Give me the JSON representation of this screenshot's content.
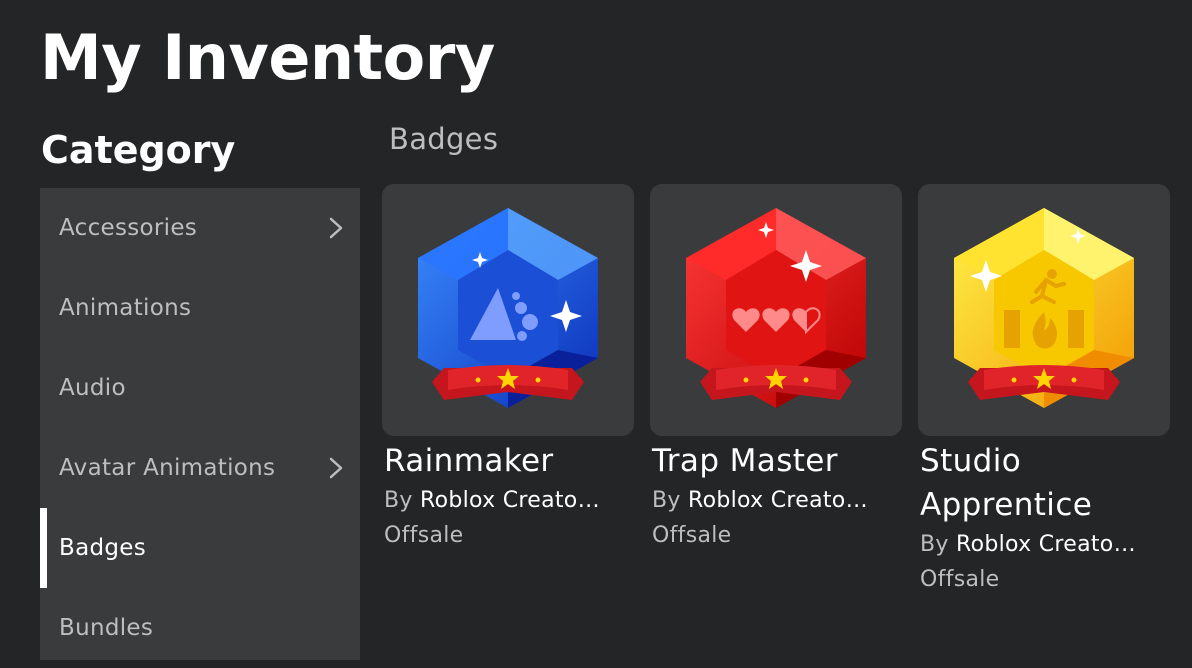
{
  "page": {
    "title": "My Inventory"
  },
  "sidebar": {
    "heading": "Category",
    "items": [
      {
        "label": "Accessories",
        "has_submenu": true,
        "active": false
      },
      {
        "label": "Animations",
        "has_submenu": false,
        "active": false
      },
      {
        "label": "Audio",
        "has_submenu": false,
        "active": false
      },
      {
        "label": "Avatar Animations",
        "has_submenu": true,
        "active": false
      },
      {
        "label": "Badges",
        "has_submenu": false,
        "active": true
      },
      {
        "label": "Bundles",
        "has_submenu": false,
        "active": false
      }
    ]
  },
  "main": {
    "section_label": "Badges",
    "badges": [
      {
        "name": "Rainmaker",
        "by_label": "By",
        "creator": "Roblox Creato…",
        "price": "Offsale",
        "color": "#1f6be8",
        "emblem": "rainmaker-emblem-icon"
      },
      {
        "name": "Trap Master",
        "by_label": "By",
        "creator": "Roblox Creato…",
        "price": "Offsale",
        "color": "#e8141a",
        "emblem": "three-hearts-icon"
      },
      {
        "name": "Studio Apprentice",
        "by_label": "By",
        "creator": "Roblox Creato…",
        "price": "Offsale",
        "color": "#f6c800",
        "emblem": "running-over-fire-icon"
      }
    ]
  },
  "colors": {
    "background": "#232527",
    "sidebar_background": "#393b3d",
    "card_background": "#393b3d",
    "text_primary": "#ffffff",
    "text_secondary": "#bdbebe"
  }
}
